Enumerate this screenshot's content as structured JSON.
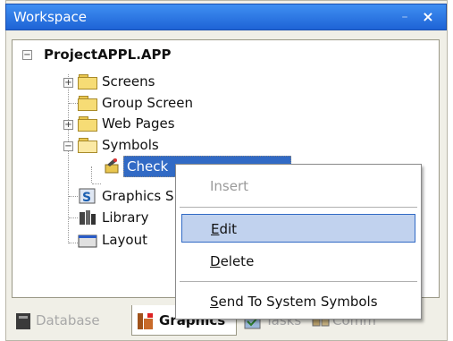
{
  "window": {
    "title": "Workspace",
    "pin_glyph": "–",
    "close_glyph": "×"
  },
  "tree": {
    "root": {
      "label": "ProjectAPPL.APP",
      "expander": "−"
    },
    "items": [
      {
        "label": "Screens",
        "expander": "+",
        "icon": "folder-icon"
      },
      {
        "label": "Group Screen",
        "icon": "folder-icon"
      },
      {
        "label": "Web Pages",
        "expander": "+",
        "icon": "folder-icon"
      },
      {
        "label": "Symbols",
        "expander": "−",
        "icon": "open-folder-icon"
      },
      {
        "label": "Check",
        "icon": "symbol-icon",
        "selected": true
      },
      {
        "label": "Graphics Script",
        "icon": "graphics-script-icon"
      },
      {
        "label": "Library",
        "icon": "library-icon"
      },
      {
        "label": "Layout",
        "icon": "layout-icon"
      }
    ]
  },
  "context_menu": {
    "items": [
      {
        "label": "Insert",
        "state": "disabled"
      },
      {
        "label_ul": "E",
        "label_rest": "dit",
        "state": "hover"
      },
      {
        "label_ul": "D",
        "label_rest": "elete",
        "state": "normal"
      },
      {
        "label_ul": "S",
        "label_rest": "end To System Symbols",
        "state": "normal"
      }
    ]
  },
  "bottom_tabs": [
    {
      "label": "Database",
      "icon": "database-icon",
      "active": false
    },
    {
      "label": "Graphics",
      "icon": "graphics-icon",
      "active": true
    },
    {
      "label": "Tasks",
      "icon": "tasks-icon",
      "active": false
    },
    {
      "label": "Comm",
      "icon": "comm-icon",
      "active": false
    }
  ],
  "colors": {
    "title_bar": "#1e63d6",
    "selection": "#316ac5",
    "hover": "#c1d2ee",
    "folder": "#f6dc75"
  }
}
